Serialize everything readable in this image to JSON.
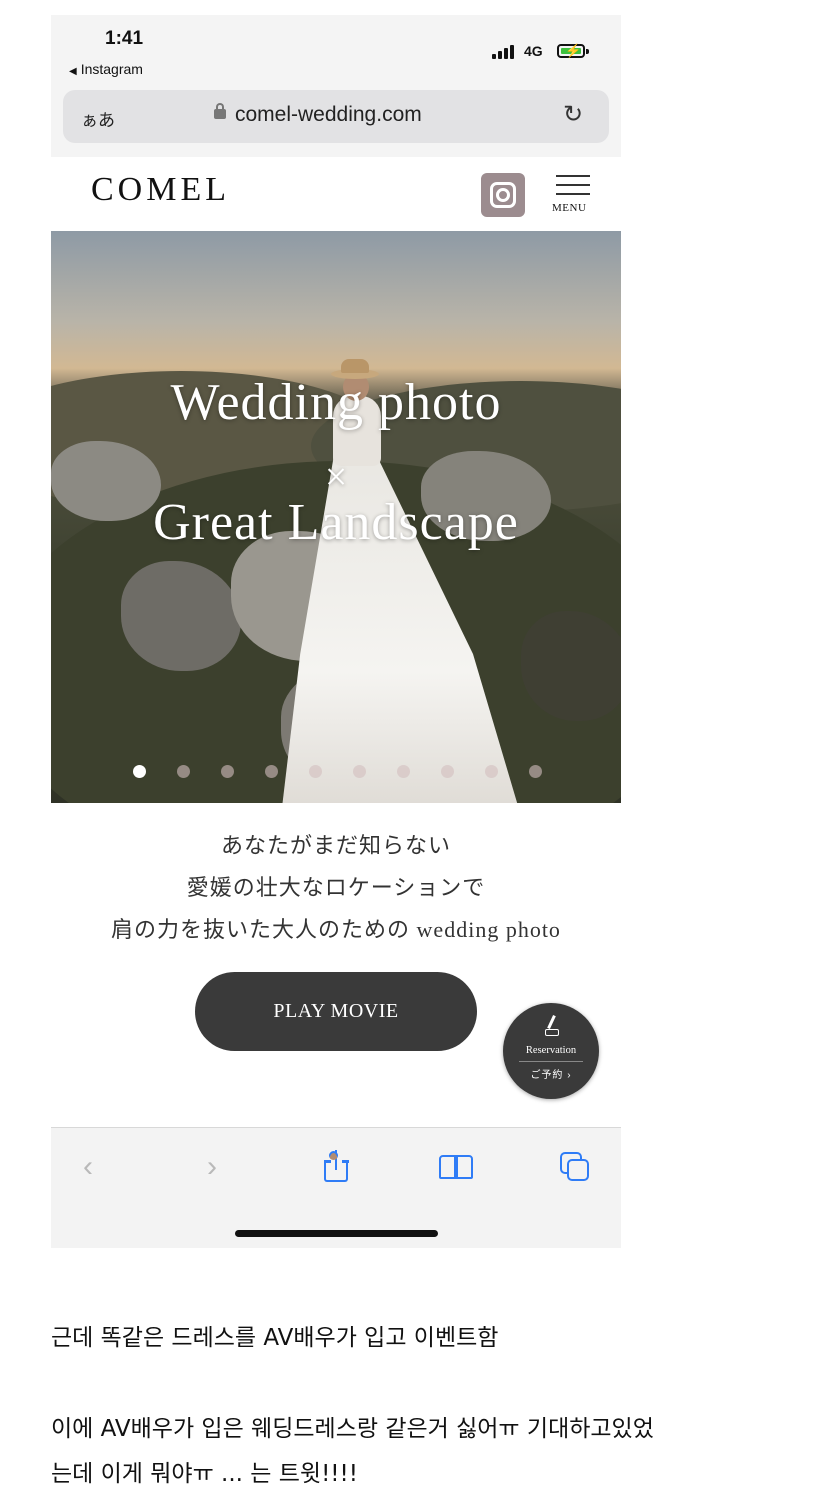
{
  "status_bar": {
    "time": "1:41",
    "back_app": "Instagram",
    "network": "4G"
  },
  "address_bar": {
    "text_size": "ぁあ",
    "url": "comel-wedding.com"
  },
  "site": {
    "logo": "COMEL",
    "menu_label": "MENU"
  },
  "hero": {
    "title_line1": "Wedding photo",
    "times_symbol": "×",
    "title_line2": "Great Landscape",
    "slide_count": 10,
    "active_slide": 0
  },
  "intro": {
    "lines": [
      "あなたがまだ知らない",
      "愛媛の壮大なロケーションで",
      "肩の力を抜いた大人のための wedding photo"
    ]
  },
  "play_button": "PLAY MOVIE",
  "reservation": {
    "label": "Reservation",
    "sub": "ご予約 ›"
  },
  "toolbar": {
    "back": "‹",
    "forward": "›"
  },
  "caption": {
    "line1": "근데 똑같은 드레스를 AV배우가 입고 이벤트함",
    "line2": "이에 AV배우가 입은 웨딩드레스랑 같은거 싫어ㅠ 기대하고있었",
    "line3": "는데 이게 뭐야ㅠ ... 는 트윗!!!!"
  },
  "colors": {
    "accent_blue": "#2f7cf6",
    "button_dark": "#3a3a3a",
    "insta_bg": "#9c8c8f"
  }
}
